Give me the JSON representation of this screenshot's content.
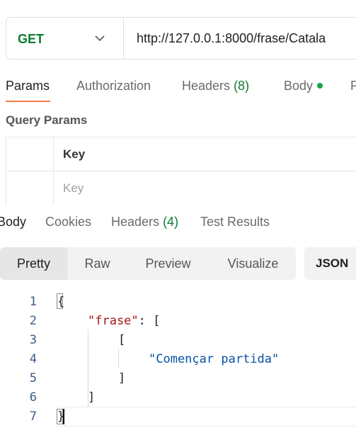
{
  "request": {
    "method": "GET",
    "url": "http://127.0.0.1:8000/frase/Catala"
  },
  "request_tabs": [
    {
      "label": "Params",
      "active": true
    },
    {
      "label": "Authorization"
    },
    {
      "label": "Headers",
      "count": "(8)"
    },
    {
      "label": "Body",
      "indicator": "green-dot"
    },
    {
      "label": "P"
    }
  ],
  "query_params": {
    "title": "Query Params",
    "column_header": "Key",
    "key_placeholder": "Key"
  },
  "response_tabs": [
    {
      "label": "Body",
      "active": true
    },
    {
      "label": "Cookies"
    },
    {
      "label": "Headers",
      "count": "(4)"
    },
    {
      "label": "Test Results"
    }
  ],
  "format_options": [
    "Pretty",
    "Raw",
    "Preview",
    "Visualize"
  ],
  "format_active": "Pretty",
  "language": "JSON",
  "response_body": {
    "line_numbers": [
      "1",
      "2",
      "3",
      "4",
      "5",
      "6",
      "7"
    ],
    "lines": [
      {
        "punct": "{"
      },
      {
        "key": "\"frase\"",
        "punct": ": ["
      },
      {
        "punct": "["
      },
      {
        "string": "\"Començar partida\""
      },
      {
        "punct": "]"
      },
      {
        "punct": "]"
      },
      {
        "punct": "}"
      }
    ]
  },
  "colors": {
    "method_get": "#0a7c32",
    "active_tab_underline": "#f37b4a",
    "json_key": "#a31515",
    "json_string": "#0451a5",
    "count_green": "#0a7c32"
  }
}
